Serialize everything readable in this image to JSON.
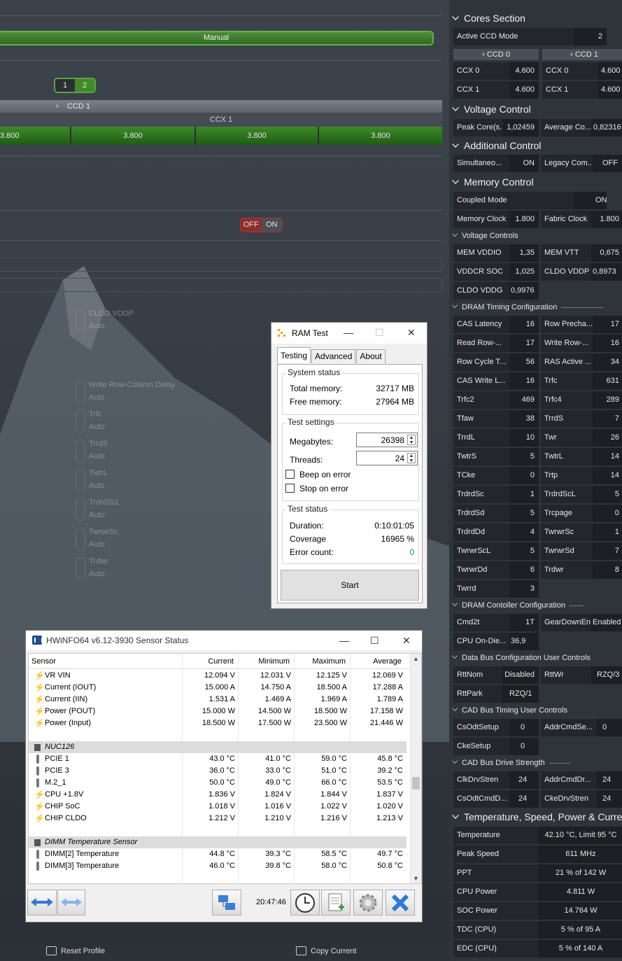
{
  "left": {
    "mode_value": "Manual",
    "ccd_toggle": [
      "1",
      "2"
    ],
    "ccd_label": "CCD 1",
    "ccx_label": "CCX 1",
    "freqs": [
      "3.800",
      "3.800",
      "3.800",
      "3.800"
    ],
    "off_label": "OFF",
    "on_label": "ON",
    "ghost_items": [
      {
        "label": "CLDO VDDP",
        "value": "Auto"
      },
      {
        "label": "Write Row-Column Delay",
        "value": "Auto"
      },
      {
        "label": "Trfc",
        "value": "Auto"
      },
      {
        "label": "TrrdS",
        "value": "Auto"
      },
      {
        "label": "TwtrL",
        "value": "Auto"
      },
      {
        "label": "TrdrdScL",
        "value": "Auto"
      },
      {
        "label": "TwrwrSc",
        "value": "Auto"
      },
      {
        "label": "Trdwr",
        "value": "Auto"
      }
    ],
    "reset_profile": "Reset Profile",
    "copy_current": "Copy Current"
  },
  "right": {
    "cores_section": "Cores Section",
    "active_ccd_label": "Active CCD Mode",
    "active_ccd_value": "2",
    "ccd0": "CCD 0",
    "ccd1": "CCD 1",
    "ccx0a": {
      "label": "CCX 0",
      "value": "4.600"
    },
    "ccx0b": {
      "label": "CCX 0",
      "value": "4.600"
    },
    "ccx1a": {
      "label": "CCX 1",
      "value": "4.600"
    },
    "ccx1b": {
      "label": "CCX 1",
      "value": "4.600"
    },
    "voltage_control": "Voltage Control",
    "peak_core": {
      "label": "Peak Core(s...",
      "value": "1,02459"
    },
    "average_core": {
      "label": "Average Co...",
      "value": "0,82316"
    },
    "additional_control": "Additional Control",
    "simultaneous": {
      "label": "Simultaneo...",
      "value": "ON"
    },
    "legacy": {
      "label": "Legacy Com...",
      "value": "OFF"
    },
    "memory_control": "Memory Control",
    "coupled_mode": {
      "label": "Coupled Mode",
      "value": "ON"
    },
    "memory_clock": {
      "label": "Memory Clock",
      "value": "1.800"
    },
    "fabric_clock": {
      "label": "Fabric Clock",
      "value": "1.800"
    },
    "voltage_controls": "Voltage Controls",
    "mem_vddio": {
      "label": "MEM VDDIO",
      "value": "1,35"
    },
    "mem_vtt": {
      "label": "MEM VTT",
      "value": "0,675"
    },
    "vddcr_soc": {
      "label": "VDDCR SOC",
      "value": "1,025"
    },
    "cldo_vddp": {
      "label": "CLDO VDDP",
      "value": "0,8973"
    },
    "cldo_vddg": {
      "label": "CLDO VDDG",
      "value": "0,9976"
    },
    "dram_timing": "DRAM Timing Configuration",
    "timings": [
      {
        "l1": "CAS Latency",
        "v1": "16",
        "l2": "Row Precha...",
        "v2": "17"
      },
      {
        "l1": "Read Row-...",
        "v1": "17",
        "l2": "Write Row-...",
        "v2": "16"
      },
      {
        "l1": "Row Cycle T...",
        "v1": "56",
        "l2": "RAS Active ...",
        "v2": "34"
      },
      {
        "l1": "CAS Write L...",
        "v1": "16",
        "l2": "Trfc",
        "v2": "631"
      },
      {
        "l1": "Trfc2",
        "v1": "469",
        "l2": "Trfc4",
        "v2": "289"
      },
      {
        "l1": "Tfaw",
        "v1": "38",
        "l2": "TrrdS",
        "v2": "7"
      },
      {
        "l1": "TrrdL",
        "v1": "10",
        "l2": "Twr",
        "v2": "26"
      },
      {
        "l1": "TwtrS",
        "v1": "5",
        "l2": "TwtrL",
        "v2": "14"
      },
      {
        "l1": "TCke",
        "v1": "0",
        "l2": "Trtp",
        "v2": "14"
      },
      {
        "l1": "TrdrdSc",
        "v1": "1",
        "l2": "TrdrdScL",
        "v2": "5"
      },
      {
        "l1": "TrdrdSd",
        "v1": "5",
        "l2": "Trcpage",
        "v2": "0"
      },
      {
        "l1": "TrdrdDd",
        "v1": "4",
        "l2": "TwrwrSc",
        "v2": "1"
      },
      {
        "l1": "TwrwrScL",
        "v1": "5",
        "l2": "TwrwrSd",
        "v2": "7"
      },
      {
        "l1": "TwrwrDd",
        "v1": "6",
        "l2": "Trdwr",
        "v2": "8"
      }
    ],
    "twrrd": {
      "label": "Twrrd",
      "value": "3"
    },
    "dram_controller": "DRAM Contoller Configuration",
    "cmd2t": {
      "label": "Cmd2t",
      "value": "1T"
    },
    "geardown": {
      "label": "GearDownEn",
      "value": "Enabled"
    },
    "cpu_ondie": {
      "label": "CPU On-Die...",
      "value": "36,9"
    },
    "data_bus": "Data Bus Configuration User Controls",
    "rttnom": {
      "label": "RttNom",
      "value": "Disabled"
    },
    "rttwr": {
      "label": "RttWr",
      "value": "RZQ/3"
    },
    "rttpark": {
      "label": "RttPark",
      "value": "RZQ/1"
    },
    "cad_timing": "CAD Bus Timing User Controls",
    "csodtsetup": {
      "label": "CsOdtSetup",
      "value": "0"
    },
    "addrcmdsetup": {
      "label": "AddrCmdSe...",
      "value": "0"
    },
    "ckesetup": {
      "label": "CkeSetup",
      "value": "0"
    },
    "cad_drive": "CAD Bus Drive Strength",
    "clkdrvstren": {
      "label": "ClkDrvStren",
      "value": "24"
    },
    "addrcmddrv": {
      "label": "AddrCmdDr...",
      "value": "24"
    },
    "csodtcmd": {
      "label": "CsOdtCmdD...",
      "value": "24"
    },
    "ckedrvstren": {
      "label": "CkeDrvStren",
      "value": "24"
    },
    "temp_section": "Temperature, Speed, Power & Current",
    "stats": [
      {
        "label": "Temperature",
        "value": "42.10 °C, Limit 95 °C"
      },
      {
        "label": "Peak Speed",
        "value": "611 MHz"
      },
      {
        "label": "PPT",
        "value": "21 % of 142 W"
      },
      {
        "label": "CPU Power",
        "value": "4.811 W"
      },
      {
        "label": "SOC Power",
        "value": "14.764 W"
      },
      {
        "label": "TDC (CPU)",
        "value": "5 % of 95 A"
      },
      {
        "label": "EDC (CPU)",
        "value": "5 % of 140 A"
      }
    ]
  },
  "ramtest": {
    "title": "RAM Test",
    "tabs": [
      "Testing",
      "Advanced",
      "About"
    ],
    "system_status": "System status",
    "total_memory_label": "Total memory:",
    "total_memory": "32717 MB",
    "free_memory_label": "Free memory:",
    "free_memory": "27964 MB",
    "test_settings": "Test settings",
    "megabytes_label": "Megabytes:",
    "megabytes": "26398",
    "threads_label": "Threads:",
    "threads": "24",
    "beep_on_error": "Beep on error",
    "stop_on_error": "Stop on error",
    "test_status": "Test status",
    "duration_label": "Duration:",
    "duration": "0:10:01:05",
    "coverage_label": "Coverage",
    "coverage": "16965 %",
    "error_count_label": "Error count:",
    "error_count": "0",
    "start": "Start"
  },
  "hwinfo": {
    "title": "HWiNFO64 v6.12-3930 Sensor Status",
    "columns": [
      "Sensor",
      "Current",
      "Minimum",
      "Maximum",
      "Average"
    ],
    "rows": [
      {
        "icon": "bolt",
        "name": "VR VIN",
        "cur": "12.094 V",
        "min": "12.031 V",
        "max": "12.125 V",
        "avg": "12.069 V"
      },
      {
        "icon": "bolt",
        "name": "Current (IOUT)",
        "cur": "15.000 A",
        "min": "14.750 A",
        "max": "18.500 A",
        "avg": "17.288 A"
      },
      {
        "icon": "bolt",
        "name": "Current (IIN)",
        "cur": "1.531 A",
        "min": "1.469 A",
        "max": "1.969 A",
        "avg": "1.789 A"
      },
      {
        "icon": "bolt",
        "name": "Power (POUT)",
        "cur": "15.000 W",
        "min": "14.500 W",
        "max": "18.500 W",
        "avg": "17.158 W"
      },
      {
        "icon": "bolt",
        "name": "Power (Input)",
        "cur": "18.500 W",
        "min": "17.500 W",
        "max": "23.500 W",
        "avg": "21.446 W"
      },
      {
        "icon": "none",
        "name": "",
        "cur": "",
        "min": "",
        "max": "",
        "avg": ""
      },
      {
        "icon": "chip",
        "name": "NUC126",
        "group": true,
        "cur": "",
        "min": "",
        "max": "",
        "avg": ""
      },
      {
        "icon": "therm",
        "name": "PCIE 1",
        "cur": "43.0 °C",
        "min": "41.0 °C",
        "max": "59.0 °C",
        "avg": "45.8 °C"
      },
      {
        "icon": "therm",
        "name": "PCIE 3",
        "cur": "36.0 °C",
        "min": "33.0 °C",
        "max": "51.0 °C",
        "avg": "39.2 °C"
      },
      {
        "icon": "therm",
        "name": "M.2_1",
        "cur": "50.0 °C",
        "min": "49.0 °C",
        "max": "66.0 °C",
        "avg": "53.5 °C"
      },
      {
        "icon": "bolt",
        "name": "CPU +1.8V",
        "cur": "1.836 V",
        "min": "1.824 V",
        "max": "1.844 V",
        "avg": "1.837 V"
      },
      {
        "icon": "bolt",
        "name": "CHIP SoC",
        "cur": "1.018 V",
        "min": "1.016 V",
        "max": "1.022 V",
        "avg": "1.020 V"
      },
      {
        "icon": "bolt",
        "name": "CHIP CLDO",
        "cur": "1.212 V",
        "min": "1.210 V",
        "max": "1.216 V",
        "avg": "1.213 V"
      },
      {
        "icon": "none",
        "name": "",
        "cur": "",
        "min": "",
        "max": "",
        "avg": ""
      },
      {
        "icon": "chip",
        "name": "DIMM Temperature Sensor",
        "group": true,
        "cur": "",
        "min": "",
        "max": "",
        "avg": ""
      },
      {
        "icon": "therm",
        "name": "DIMM[2] Temperature",
        "cur": "44.8 °C",
        "min": "39.3 °C",
        "max": "58.5 °C",
        "avg": "49.7 °C"
      },
      {
        "icon": "therm",
        "name": "DIMM[3] Temperature",
        "cur": "46.0 °C",
        "min": "39.8 °C",
        "max": "58.0 °C",
        "avg": "50.8 °C"
      }
    ],
    "time": "20:47:46"
  }
}
